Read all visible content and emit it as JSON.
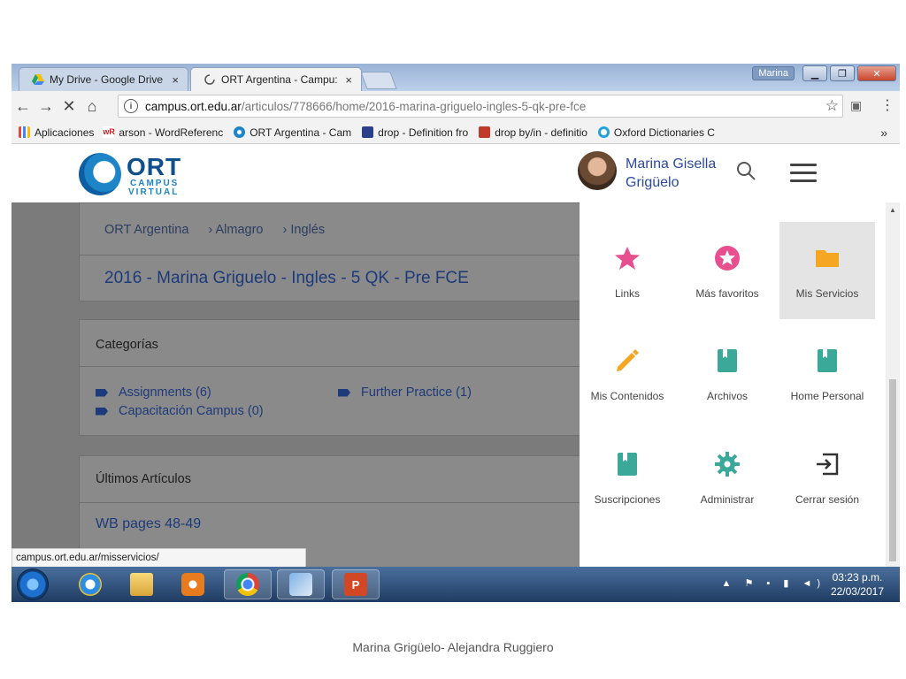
{
  "browser": {
    "tabs": [
      {
        "label": "My Drive - Google Drive",
        "close": "×"
      },
      {
        "label": "ORT Argentina - Campu:",
        "close": "×"
      }
    ],
    "window_user": "Marina",
    "address": {
      "host": "campus.ort.edu.ar",
      "path": "/articulos/778666/home/2016-marina-griguelo-ingles-5-qk-pre-fce"
    },
    "bookmarks": [
      {
        "label": "Aplicaciones",
        "icon": "apps-grid-icon"
      },
      {
        "label": "arson - WordReferenc",
        "icon": "wordreference-icon"
      },
      {
        "label": "ORT Argentina - Cam",
        "icon": "ort-icon"
      },
      {
        "label": "drop - Definition fro",
        "icon": "dictionary-icon"
      },
      {
        "label": "drop by/in - definitio",
        "icon": "cambridge-icon"
      },
      {
        "label": "Oxford Dictionaries C",
        "icon": "oxford-icon"
      }
    ],
    "bookmarks_more": "»",
    "status_url": "campus.ort.edu.ar/misservicios/"
  },
  "site": {
    "logo_text": "ORT",
    "logo_sub1": "CAMPUS",
    "logo_sub2": "VIRTUAL",
    "user_name": "Marina Gisella Grigüelo"
  },
  "main": {
    "breadcrumb": [
      "ORT Argentina",
      "› Almagro",
      "› Inglés"
    ],
    "title": "2016 - Marina Griguelo - Ingles - 5 QK - Pre FCE",
    "categories_heading": "Categorías",
    "categories": [
      {
        "label": "Assignments (6)"
      },
      {
        "label": "Capacitación Campus (0)"
      },
      {
        "label": "Further Practice (1)"
      }
    ],
    "latest_heading": "Últimos Artículos",
    "latest_articles": [
      "WB pages 48-49"
    ]
  },
  "menu": {
    "items": [
      {
        "label": "Links",
        "icon": "star-icon",
        "color": "#e84f8f"
      },
      {
        "label": "Más favoritos",
        "icon": "star-circle-icon",
        "color": "#e84f8f"
      },
      {
        "label": "Mis Servicios",
        "icon": "folder-icon",
        "color": "#f5a623",
        "selected": true
      },
      {
        "label": "Mis Contenidos",
        "icon": "pencil-icon",
        "color": "#f5a623"
      },
      {
        "label": "Archivos",
        "icon": "book-icon",
        "color": "#3aa99a"
      },
      {
        "label": "Home Personal",
        "icon": "book-icon",
        "color": "#3aa99a"
      },
      {
        "label": "Suscripciones",
        "icon": "book-icon",
        "color": "#3aa99a"
      },
      {
        "label": "Administrar",
        "icon": "gear-icon",
        "color": "#3aa99a"
      },
      {
        "label": "Cerrar sesión",
        "icon": "logout-icon",
        "color": "#333333"
      }
    ]
  },
  "taskbar": {
    "time": "03:23 p.m.",
    "date": "22/03/2017"
  },
  "footer": {
    "credit": "Marina Grigüelo- Alejandra Ruggiero"
  },
  "colors": {
    "link_blue": "#1d3a7a",
    "user_blue": "#2b4aa0"
  }
}
